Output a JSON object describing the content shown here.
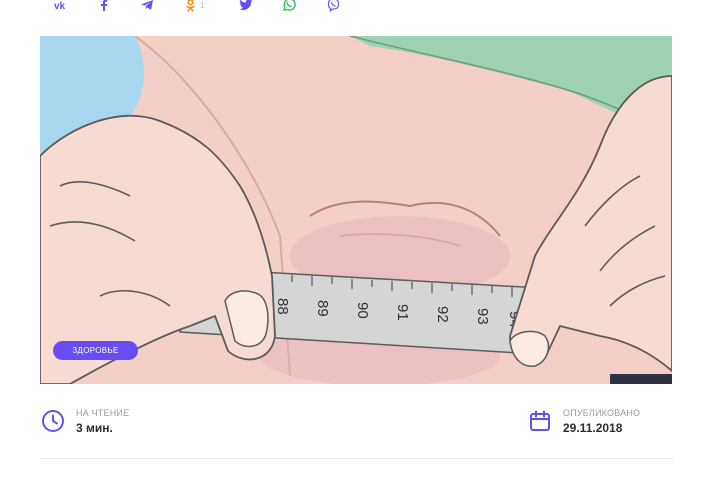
{
  "share": {
    "buttons": [
      {
        "icon": "vk-icon"
      },
      {
        "icon": "facebook-icon"
      },
      {
        "icon": "telegram-icon"
      },
      {
        "icon": "odnoklassniki-icon",
        "count": "1"
      },
      {
        "icon": "twitter-icon"
      },
      {
        "icon": "whatsapp-icon"
      },
      {
        "icon": "viber-icon"
      }
    ],
    "icon_color": "#6a4df2"
  },
  "hero": {
    "tape_numbers": [
      "88",
      "89",
      "90",
      "91",
      "92",
      "93",
      "94"
    ],
    "category_tag": "ЗДОРОВЬЕ"
  },
  "meta": {
    "read_label": "НА ЧТЕНИЕ",
    "read_value": "3 мин.",
    "published_label": "ОПУБЛИКОВАНО",
    "published_value": "29.11.2018"
  },
  "colors": {
    "accent": "#6a4df2",
    "skin": "#f3cfc7",
    "cloth": "#9fd1b3",
    "tape": "#d5d5d5"
  }
}
